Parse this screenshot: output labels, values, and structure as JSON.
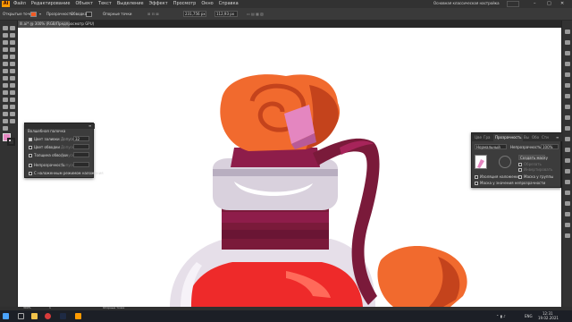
{
  "menubar": {
    "app_logo": "Ai",
    "items": [
      "Файл",
      "Редактирование",
      "Объект",
      "Текст",
      "Выделение",
      "Эффект",
      "Просмотр",
      "Окно",
      "Справка"
    ],
    "workspace": "Основная классическая настройка",
    "window_buttons": [
      "–",
      "□",
      "✕"
    ]
  },
  "controlbar": {
    "selection_status": "Открытые точки",
    "opacity_label": "Прозрачность",
    "stroke_label": "Обводка",
    "points_label": "Опорные точки",
    "x_value": "231,756 px",
    "y_value": "112,93 px",
    "fill_color": "#f15a24",
    "stroke_color": "#2b2b2b"
  },
  "document": {
    "tab_label": "Ill.ai* @ 300% (RGB/Предпросмотр GPU)",
    "close_glyph": "✕"
  },
  "stroke_panel": {
    "title": "Волшебная палочка",
    "rows": [
      {
        "label": "Цвет заливки",
        "checked": true,
        "field_label": "Допуск",
        "value": "32"
      },
      {
        "label": "Цвет обводки",
        "checked": false,
        "field_label": "Допуск",
        "value": ""
      },
      {
        "label": "Толщина обводки",
        "checked": false,
        "field_label": "Допуск",
        "value": ""
      },
      {
        "label": "Непрозрачность",
        "checked": false,
        "field_label": "Допуск",
        "value": ""
      },
      {
        "label": "С наложенным режимом наложения",
        "checked": false,
        "field_label": "",
        "value": ""
      }
    ]
  },
  "transparency_panel": {
    "tabs": [
      "Цве",
      "Гра",
      "Прозрачность",
      "Вы",
      "Обо",
      "Сти"
    ],
    "active_tab": "Прозрачность",
    "blend_mode": "Нормальный",
    "opacity_label": "Непрозрачность:",
    "opacity_value": "100%",
    "make_mask_button": "Создать маску",
    "clip_label": "Обрезать",
    "invert_label": "Инвертировать",
    "options": [
      "Изоляция наложения",
      "Маска у группы",
      "Маска у значения непрозрачности"
    ]
  },
  "statusbar": {
    "zoom": "300%",
    "page": "1",
    "tool": "Опорные точки"
  },
  "taskbar": {
    "lang": "ENG",
    "time": "12:31",
    "date": "19.02.2021"
  },
  "colors": {
    "accent": "#ff9a00",
    "canvas": "#ffffff",
    "cap": "#f16a2e",
    "cap_shadow": "#c4431c",
    "ribbon": "#8e1d4a",
    "neck": "#7a1a3a",
    "liquid": "#ee2a2a",
    "glass": "#e6dfe9"
  }
}
